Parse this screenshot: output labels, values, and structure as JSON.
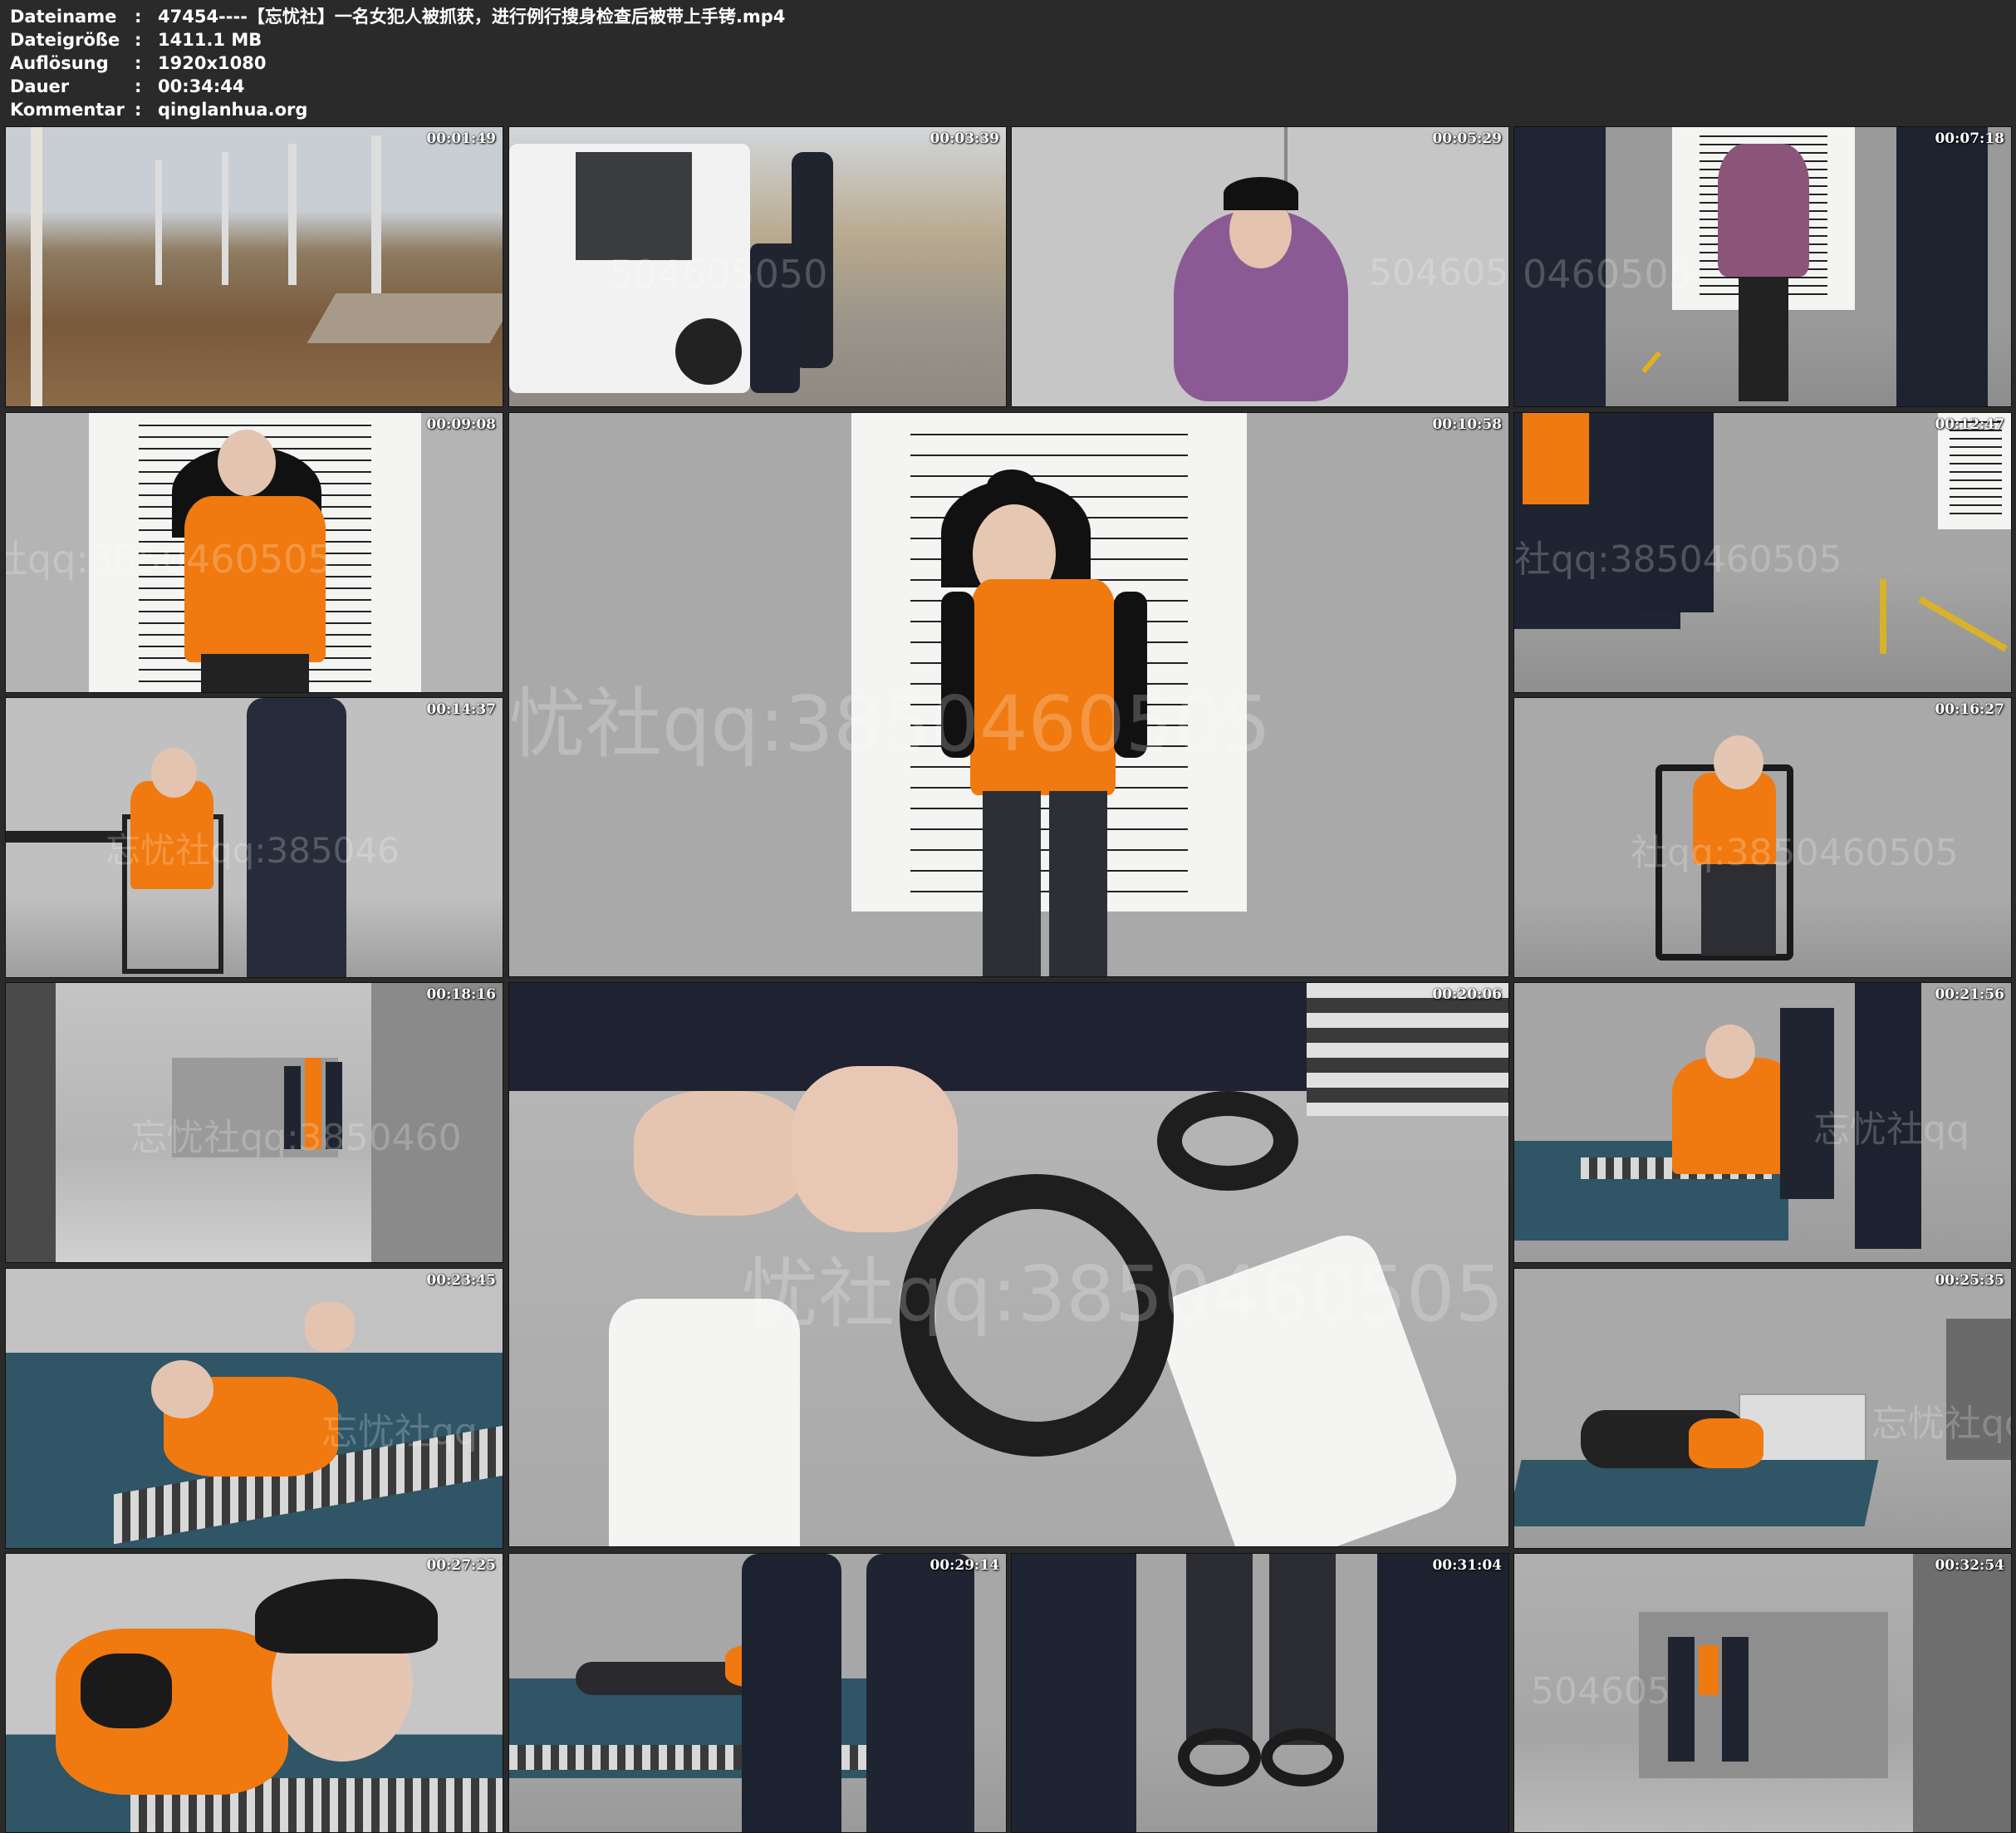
{
  "header": {
    "rows": [
      {
        "key": "Dateiname",
        "sep": ":",
        "value": "47454----【忘忧社】一名女犯人被抓获，进行例行搜身检查后被带上手铐.mp4"
      },
      {
        "key": "Dateigröße",
        "sep": ":",
        "value": "1411.1 MB"
      },
      {
        "key": "Auflösung",
        "sep": ":",
        "value": "1920x1080"
      },
      {
        "key": "Dauer",
        "sep": ":",
        "value": "00:34:44"
      },
      {
        "key": "Kommentar",
        "sep": ":",
        "value": "qinglanhua.org"
      }
    ]
  },
  "thumbnails": [
    {
      "timestamp": "00:01:49"
    },
    {
      "timestamp": "00:03:39"
    },
    {
      "timestamp": "00:05:29"
    },
    {
      "timestamp": "00:07:18"
    },
    {
      "timestamp": "00:09:08"
    },
    {
      "timestamp": "00:10:58"
    },
    {
      "timestamp": "00:12:47"
    },
    {
      "timestamp": "00:14:37"
    },
    {
      "timestamp": "00:16:27"
    },
    {
      "timestamp": "00:18:16"
    },
    {
      "timestamp": "00:20:06"
    },
    {
      "timestamp": "00:21:56"
    },
    {
      "timestamp": "00:23:45"
    },
    {
      "timestamp": "00:25:35"
    },
    {
      "timestamp": "00:27:25"
    },
    {
      "timestamp": "00:29:14"
    },
    {
      "timestamp": "00:31:04"
    },
    {
      "timestamp": "00:32:54"
    }
  ],
  "watermarks": {
    "a": "504605050",
    "b": "504605",
    "c": "社qq:3850460505",
    "d": "忧社qq:3850460505",
    "e": "忘忧社qq:3850460",
    "f": "忘忧社qq",
    "g": "忘忧社qq:385046",
    "h": "0460505"
  },
  "colors": {
    "background": "#2a2a2a",
    "vest": "#f07a10",
    "wall": "#a8a8a8",
    "bed": "#2f5566"
  }
}
